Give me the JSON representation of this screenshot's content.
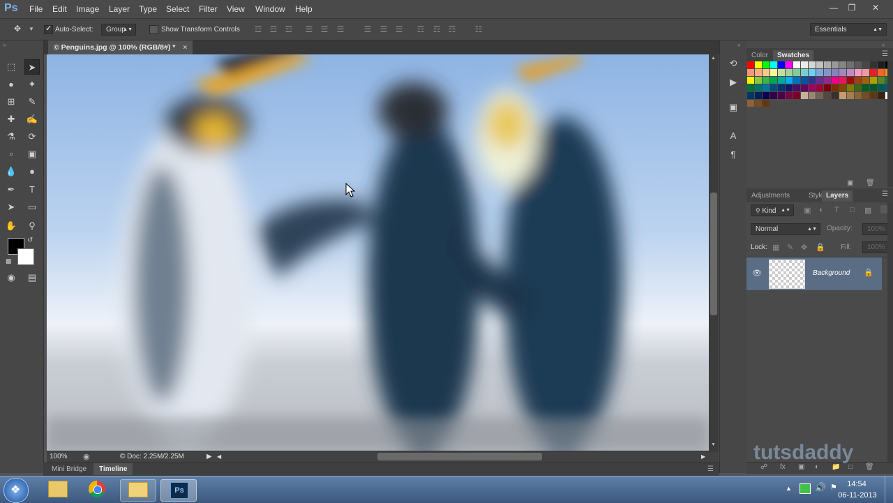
{
  "app": {
    "logo": "Ps"
  },
  "menu": [
    "File",
    "Edit",
    "Image",
    "Layer",
    "Type",
    "Select",
    "Filter",
    "View",
    "Window",
    "Help"
  ],
  "window_controls": {
    "minimize": "—",
    "restore": "❐",
    "close": "✕"
  },
  "options_bar": {
    "auto_select_label": "Auto-Select:",
    "auto_select_value": "Group",
    "show_transform_label": "Show Transform Controls",
    "workspace": "Essentials"
  },
  "document": {
    "tab_title": "© Penguins.jpg @ 100% (RGB/8#) *",
    "tab_close": "×",
    "zoom": "100%",
    "doc_size": "© Doc: 2.25M/2.25M"
  },
  "bottom_tabs": {
    "mini_bridge": "Mini Bridge",
    "timeline": "Timeline"
  },
  "swatches_panel": {
    "tab_color": "Color",
    "tab_swatches": "Swatches"
  },
  "layers_panel": {
    "tab_adjustments": "Adjustments",
    "tab_styles": "Styles",
    "tab_layers": "Layers",
    "filter_kind": "Kind",
    "blend_mode": "Normal",
    "opacity_label": "Opacity:",
    "opacity_value": "100%",
    "lock_label": "Lock:",
    "fill_label": "Fill:",
    "fill_value": "100%",
    "layer_name": "Background"
  },
  "taskbar": {
    "time": "14:54",
    "date": "06-11-2013"
  },
  "watermark": "tutsdaddy",
  "colors": {
    "accent": "#7fb3e6",
    "selected_layer": "#5b6d84"
  }
}
